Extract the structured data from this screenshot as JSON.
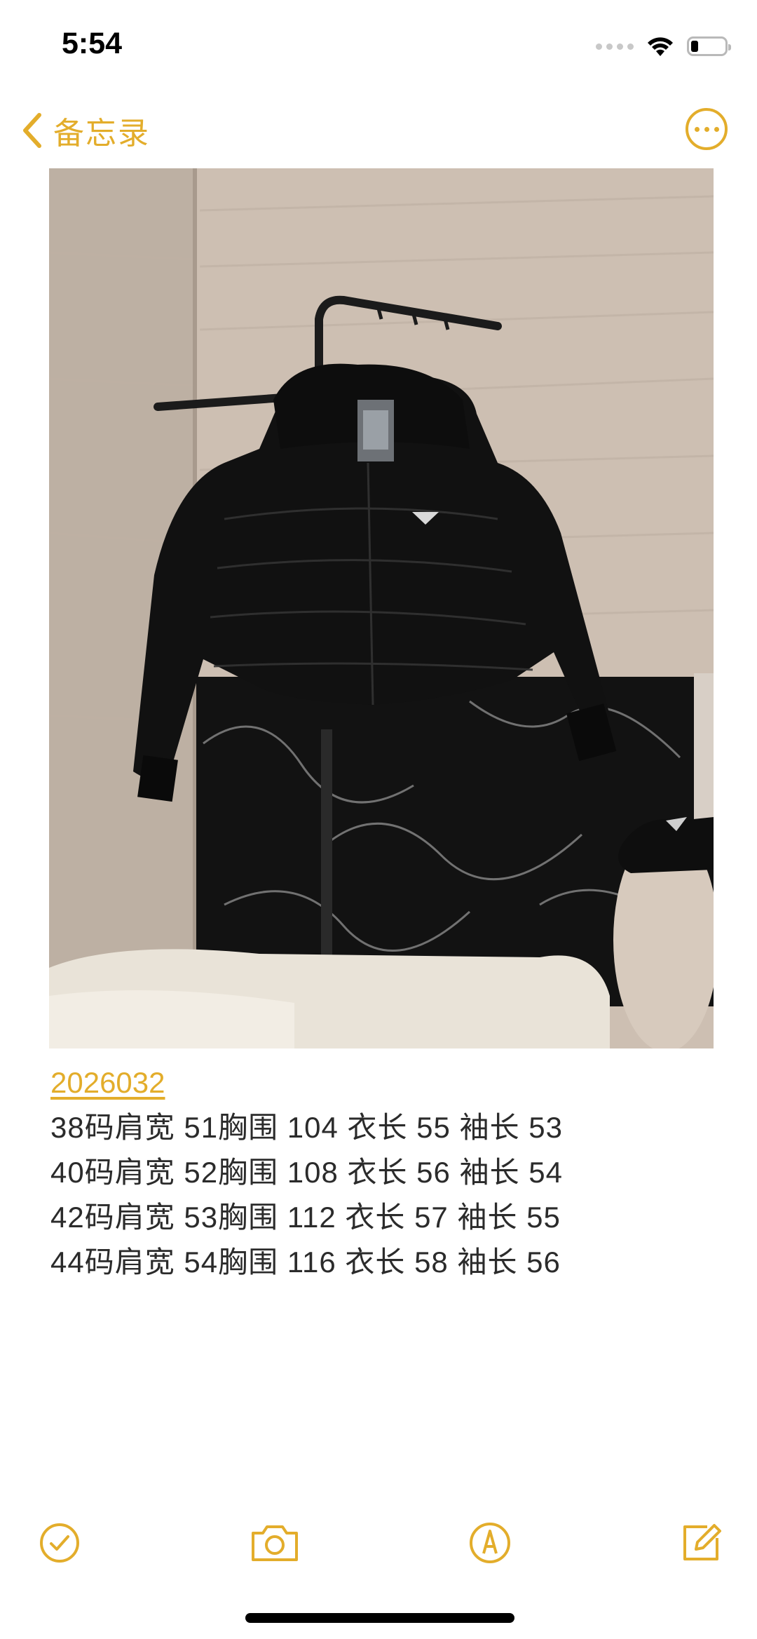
{
  "status_bar": {
    "time": "5:54"
  },
  "nav": {
    "back_label": "备忘录",
    "back_icon": "chevron-left-icon",
    "more_icon": "ellipsis-circle-icon"
  },
  "colors": {
    "accent": "#e3ad2b",
    "text": "#2b2b2b"
  },
  "note": {
    "link_text": "2026032",
    "lines": [
      "38码肩宽 51胸围 104 衣长 55 袖长 53",
      "40码肩宽 52胸围 108 衣长 56 袖长 54",
      "42码肩宽 53胸围 112 衣长 57 袖长 55",
      "44码肩宽 54胸围 116 衣长 58 袖长 56"
    ]
  },
  "toolbar": {
    "items": [
      {
        "icon": "checklist-icon"
      },
      {
        "icon": "camera-icon"
      },
      {
        "icon": "markup-pen-icon"
      },
      {
        "icon": "compose-icon"
      }
    ]
  }
}
